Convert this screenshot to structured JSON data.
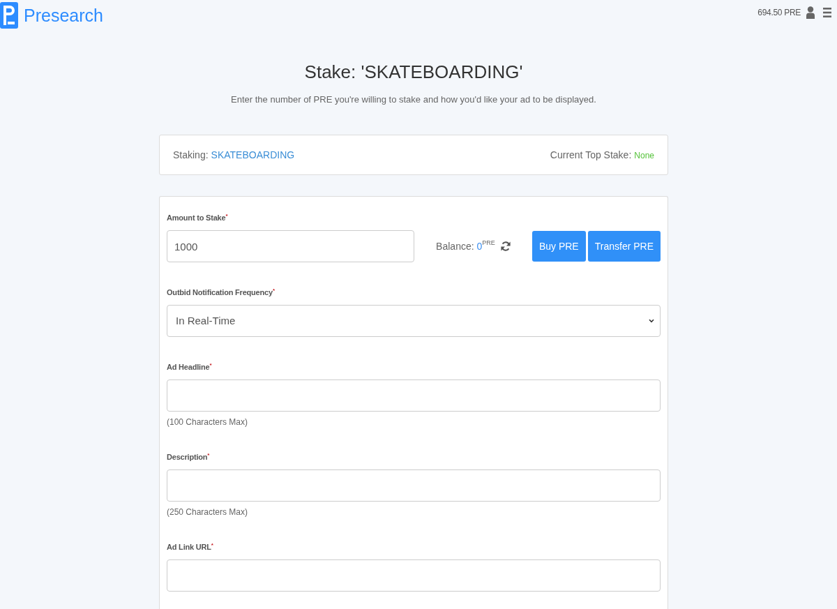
{
  "header": {
    "brand": "Presearch",
    "balance": "694.50 PRE"
  },
  "page": {
    "title": "Stake: 'SKATEBOARDING'",
    "subtitle": "Enter the number of PRE you're willing to stake and how you'd like your ad to be displayed."
  },
  "summary": {
    "staking_label": "Staking:",
    "staking_keyword": "SKATEBOARDING",
    "top_stake_label": "Current Top Stake:",
    "top_stake_value": "None"
  },
  "form": {
    "fields": [
      {
        "kind": "amount",
        "label": "Amount to Stake",
        "required_mark": "*",
        "value": "1000",
        "balance_label": "Balance:",
        "balance_value": "0",
        "balance_unit": "PRE",
        "buttons": [
          "Buy PRE",
          "Transfer PRE"
        ]
      },
      {
        "kind": "select",
        "label": "Outbid Notification Frequency",
        "required_mark": "*",
        "value": "In Real-Time"
      },
      {
        "kind": "text",
        "label": "Ad Headline",
        "required_mark": "*",
        "help": "(100 Characters Max)"
      },
      {
        "kind": "text",
        "label": "Description",
        "required_mark": "*",
        "help": "(250 Characters Max)"
      },
      {
        "kind": "text",
        "label": "Ad Link URL",
        "required_mark": "*"
      }
    ]
  }
}
